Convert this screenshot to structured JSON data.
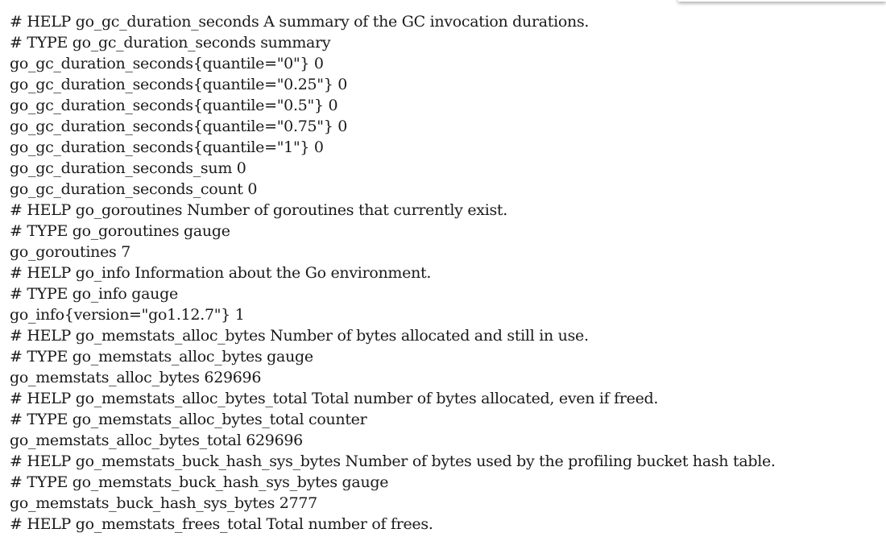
{
  "lines": [
    "# HELP go_gc_duration_seconds A summary of the GC invocation durations.",
    "# TYPE go_gc_duration_seconds summary",
    "go_gc_duration_seconds{quantile=\"0\"} 0",
    "go_gc_duration_seconds{quantile=\"0.25\"} 0",
    "go_gc_duration_seconds{quantile=\"0.5\"} 0",
    "go_gc_duration_seconds{quantile=\"0.75\"} 0",
    "go_gc_duration_seconds{quantile=\"1\"} 0",
    "go_gc_duration_seconds_sum 0",
    "go_gc_duration_seconds_count 0",
    "# HELP go_goroutines Number of goroutines that currently exist.",
    "# TYPE go_goroutines gauge",
    "go_goroutines 7",
    "# HELP go_info Information about the Go environment.",
    "# TYPE go_info gauge",
    "go_info{version=\"go1.12.7\"} 1",
    "# HELP go_memstats_alloc_bytes Number of bytes allocated and still in use.",
    "# TYPE go_memstats_alloc_bytes gauge",
    "go_memstats_alloc_bytes 629696",
    "# HELP go_memstats_alloc_bytes_total Total number of bytes allocated, even if freed.",
    "# TYPE go_memstats_alloc_bytes_total counter",
    "go_memstats_alloc_bytes_total 629696",
    "# HELP go_memstats_buck_hash_sys_bytes Number of bytes used by the profiling bucket hash table.",
    "# TYPE go_memstats_buck_hash_sys_bytes gauge",
    "go_memstats_buck_hash_sys_bytes 2777",
    "# HELP go_memstats_frees_total Total number of frees."
  ]
}
